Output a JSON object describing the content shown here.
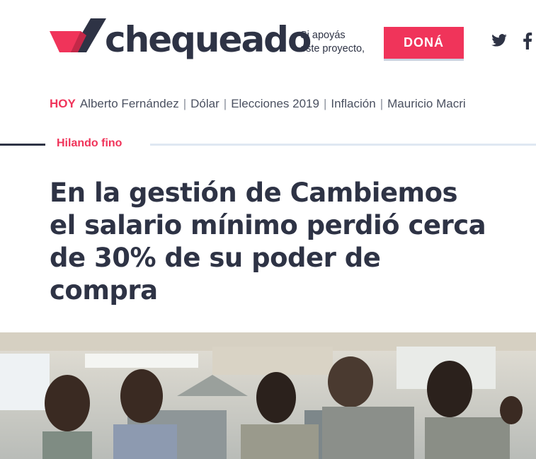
{
  "header": {
    "logo_text": "chequeado",
    "support_line1": "Si apoyás",
    "support_line2": "este proyecto,",
    "donate_label": "DONÁ"
  },
  "trending": {
    "label": "HOY",
    "items": [
      "Alberto Fernández",
      "Dólar",
      "Elecciones 2019",
      "Inflación",
      "Mauricio Macri"
    ]
  },
  "article": {
    "section": "Hilando fino",
    "title": "En la gestión de Cambiemos el salario mínimo perdió cerca de 30% de su poder de compra"
  },
  "colors": {
    "brand_red": "#f0345a",
    "brand_dark": "#2e3345",
    "divider_light": "#dfe8f2"
  },
  "icons": [
    "twitter-icon",
    "facebook-icon"
  ]
}
